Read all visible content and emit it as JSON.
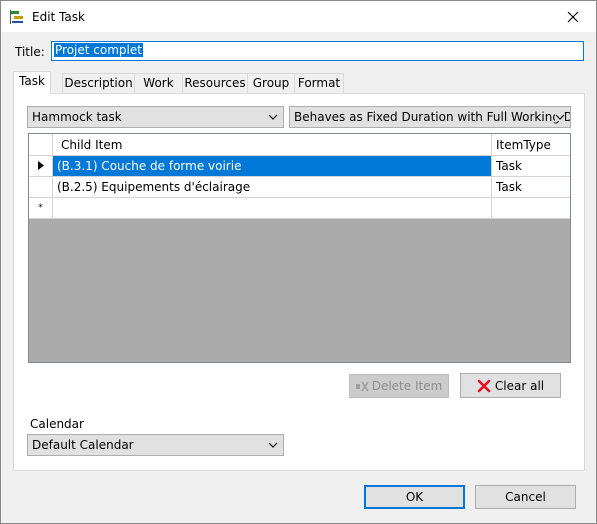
{
  "window": {
    "title": "Edit Task",
    "icon": "gantt-icon",
    "close_icon": "close-icon"
  },
  "title_field": {
    "label": "Title:",
    "value": "Projet complet"
  },
  "tabs": [
    {
      "label": "Task",
      "active": true
    },
    {
      "label": "Description",
      "active": false
    },
    {
      "label": "Work",
      "active": false
    },
    {
      "label": "Resources",
      "active": false
    },
    {
      "label": "Group",
      "active": false
    },
    {
      "label": "Format",
      "active": false
    }
  ],
  "task_panel": {
    "type_select": "Hammock task",
    "behavior_select": "Behaves as Fixed Duration with Full Working Days",
    "grid": {
      "columns": [
        "Child Item",
        "ItemType"
      ],
      "rows": [
        {
          "child": "(B.3.1) Couche de  forme voirie",
          "type": "Task",
          "selected": true
        },
        {
          "child": "(B.2.5) Equipements d'éclairage",
          "type": "Task",
          "selected": false
        }
      ],
      "new_row_marker": "*"
    },
    "delete_button": "Delete Item",
    "clear_button": "Clear all",
    "calendar_label": "Calendar",
    "calendar_select": "Default Calendar"
  },
  "footer": {
    "ok": "OK",
    "cancel": "Cancel"
  },
  "colors": {
    "accent": "#0078d7",
    "grid_background": "#ababab",
    "clear_icon": "#e81123"
  }
}
